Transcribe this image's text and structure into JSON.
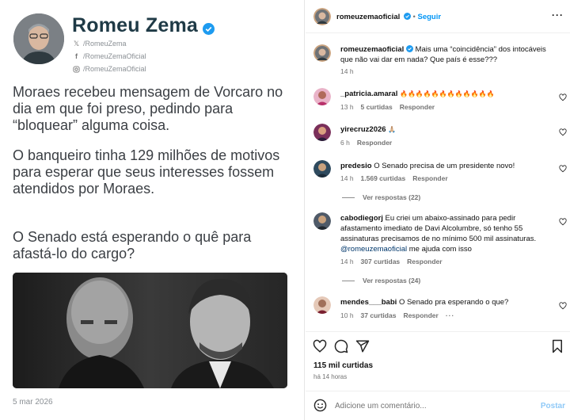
{
  "left_post": {
    "author_name": "Romeu Zema",
    "socials": [
      "/RomeuZema",
      "/RomeuZemaOficial",
      "/RomeuZemaOficial"
    ],
    "paragraphs": [
      "Moraes recebeu mensagem de Vorcaro no dia em que foi preso, pedindo para “bloquear” alguma coisa.",
      "O banqueiro tinha 129 milhões de motivos para esperar que seus interesses fossem atendidos por Moraes.",
      "O Senado está esperando o quê para afastá-lo do cargo?"
    ],
    "date": "5 mar 2026"
  },
  "header": {
    "username": "romeuzemaoficial",
    "follow_label": "Seguir",
    "more_label": "···"
  },
  "caption": {
    "username": "romeuzemaoficial",
    "text": "Mais uma “coincidência” dos intocáveis que não vai dar em nada? Que país é esse???",
    "time": "14 h"
  },
  "comments": [
    {
      "username": "_patricia.amaral",
      "text": "🔥🔥🔥🔥🔥🔥🔥🔥🔥🔥🔥🔥",
      "time": "13 h",
      "likes": "5 curtidas",
      "reply": "Responder"
    },
    {
      "username": "yirecruz2026",
      "text": "🙏🏼",
      "time": "6 h",
      "likes": "",
      "reply": "Responder"
    },
    {
      "username": "predesio",
      "text": "O Senado precisa de um presidente novo!",
      "time": "14 h",
      "likes": "1.569 curtidas",
      "reply": "Responder",
      "view_replies": "Ver respostas (22)"
    },
    {
      "username": "cabodiegorj",
      "text": "Eu criei um abaixo-assinado para pedir afastamento imediato de Davi Alcolumbre, só tenho 55 assinaturas precisamos de no mínimo 500 mil assinaturas.",
      "mention": "@romeuzemaoficial",
      "mention_tail": "me ajuda com isso",
      "time": "14 h",
      "likes": "307 curtidas",
      "reply": "Responder",
      "view_replies": "Ver respostas (24)"
    },
    {
      "username": "mendes___babi",
      "text": "O Senado pra esperando o que?",
      "time": "10 h",
      "likes": "37 curtidas",
      "reply": "Responder",
      "more": "···"
    }
  ],
  "likes_total": "115 mil curtidas",
  "post_age": "há 14 horas",
  "add_comment": {
    "placeholder": "Adicione um comentário...",
    "post_label": "Postar"
  },
  "colors": {
    "accent": "#0095f6",
    "verified": "#1d9bf0",
    "name": "#1f3a46"
  }
}
